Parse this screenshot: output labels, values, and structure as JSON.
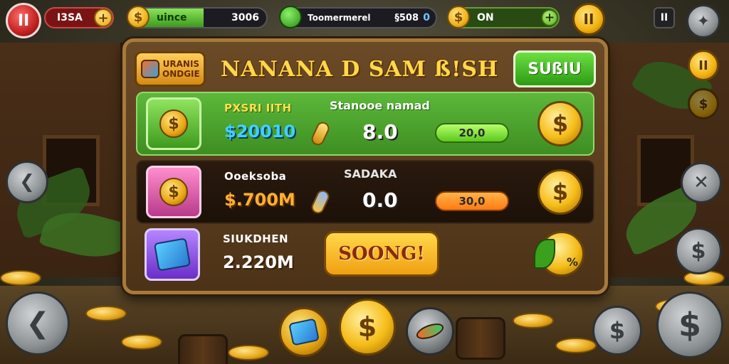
{
  "hud": {
    "pause_label": "II",
    "left_pill_text": "I3SA",
    "pill1_label": "uince",
    "pill1_value": "3006",
    "pill2_label": "Toomermerel",
    "pill2_value": "§508",
    "pill2_extra": "0",
    "pill3_label": "ON",
    "pause_gold_label": "II",
    "small_pause_label": "II"
  },
  "panel": {
    "badge_text": "URANIS\nONDGIE",
    "title": "NANANA D SAM ß!SH",
    "header_button": "SUßIU"
  },
  "items": [
    {
      "name": "PXSRI IITH",
      "price": "$20010",
      "stat_label": "Stanooe namad",
      "stat_value": "8.0",
      "progress": "20,0"
    },
    {
      "name": "Ooeksoba",
      "price": "$.700M",
      "stat_label": "SADAKA",
      "stat_value": "0.0",
      "progress": "30,0"
    },
    {
      "name": "SIUKDHEN",
      "price": "2.220M",
      "action_label": "SOONG!",
      "discount": "%"
    }
  ],
  "icons": {
    "coin": "$",
    "left_arrow": "❮",
    "close": "✕",
    "pause": "II",
    "map": "map-icon"
  },
  "colors": {
    "accent_gold": "#f5bc18",
    "accent_green": "#5ac81e",
    "accent_red": "#c0221f",
    "panel_border": "#a57a3c"
  }
}
